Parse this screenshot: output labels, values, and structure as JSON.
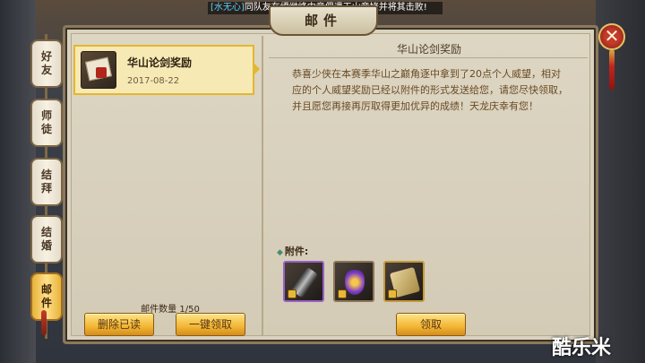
{
  "ticker": {
    "sender": "[水无心]",
    "message": "同队友在缥缈峰中竟偶遇天山童姥并将其击败!"
  },
  "window": {
    "title": "邮件"
  },
  "tabs": [
    {
      "label": "好友",
      "active": false
    },
    {
      "label": "师徒",
      "active": false
    },
    {
      "label": "结拜",
      "active": false
    },
    {
      "label": "结婚",
      "active": false
    },
    {
      "label": "邮件",
      "active": true
    }
  ],
  "mail_list": [
    {
      "title": "华山论剑奖励",
      "date": "2017-08-22",
      "icon": "reward-letter-icon"
    }
  ],
  "mail_count": "邮件数量 1/50",
  "buttons": {
    "delete_read": "删除已读",
    "claim_all": "一键领取",
    "claim": "领取"
  },
  "detail": {
    "title": "华山论剑奖励",
    "body": "恭喜少侠在本赛季华山之巅角逐中拿到了20点个人威望，相对应的个人威望奖励已经以附件的形式发送给您，请您尽快领取，并且愿您再接再厉取得更加优异的成绩！天龙庆幸有您！",
    "attachment_label": "附件:",
    "attachments": [
      {
        "icon": "black-cannon-item-icon",
        "quality": "purple",
        "locked": true
      },
      {
        "icon": "purple-gem-item-icon",
        "quality": "normal",
        "locked": true
      },
      {
        "icon": "golden-scroll-item-icon",
        "quality": "normal",
        "locked": true
      }
    ]
  },
  "watermark": "酷乐米",
  "colors": {
    "gold_button": "#f2b634",
    "selected_item": "#f6e9b4",
    "panel": "#d9d2bf",
    "body_text": "#6a4a24"
  }
}
